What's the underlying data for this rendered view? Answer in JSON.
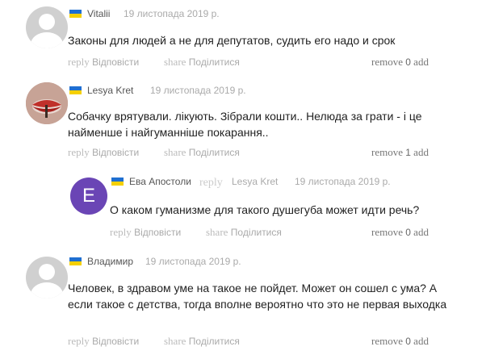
{
  "comments": [
    {
      "author": "Vitalii",
      "date": "19 листопада 2019 р.",
      "text": "Законы для людей а не для депутатов, судить его надо и срок",
      "reply_ghost": "reply",
      "reply_label": "Відповісти",
      "share_ghost": "share",
      "share_label": "Поділитися",
      "remove_label": "remove",
      "count": "0",
      "add_label": "add"
    },
    {
      "author": "Lesya Kret",
      "date": "19 листопада 2019 р.",
      "text": "Собачку врятували. лікують. Зібрали кошти.. Нелюда за грати - і це найменше і найгуманніше покарання..",
      "reply_ghost": "reply",
      "reply_label": "Відповісти",
      "share_ghost": "share",
      "share_label": "Поділитися",
      "remove_label": "remove",
      "count": "1",
      "add_label": "add"
    },
    {
      "author": "Ева Апостоли",
      "avatar_letter": "E",
      "reply_word": "reply",
      "reply_to": "Lesya Kret",
      "date": "19 листопада 2019 р.",
      "text": "О каком гуманизме для такого душегуба может идти речь?",
      "reply_ghost": "reply",
      "reply_label": "Відповісти",
      "share_ghost": "share",
      "share_label": "Поділитися",
      "remove_label": "remove",
      "count": "0",
      "add_label": "add"
    },
    {
      "author": "Владимир",
      "date": "19 листопада 2019 р.",
      "text": "Человек, в здравом уме на такое не пойдет. Может он сошел с ума? А если такое с детства, тогда вполне вероятно что это не первая выходка",
      "reply_ghost": "reply",
      "reply_label": "Відповісти",
      "share_ghost": "share",
      "share_label": "Поділитися",
      "remove_label": "remove",
      "count": "0",
      "add_label": "add"
    }
  ],
  "colors": {
    "flag_blue": "#1f6fd1",
    "flag_yellow": "#f5d000",
    "letter_avatar": "#6a45b5"
  }
}
